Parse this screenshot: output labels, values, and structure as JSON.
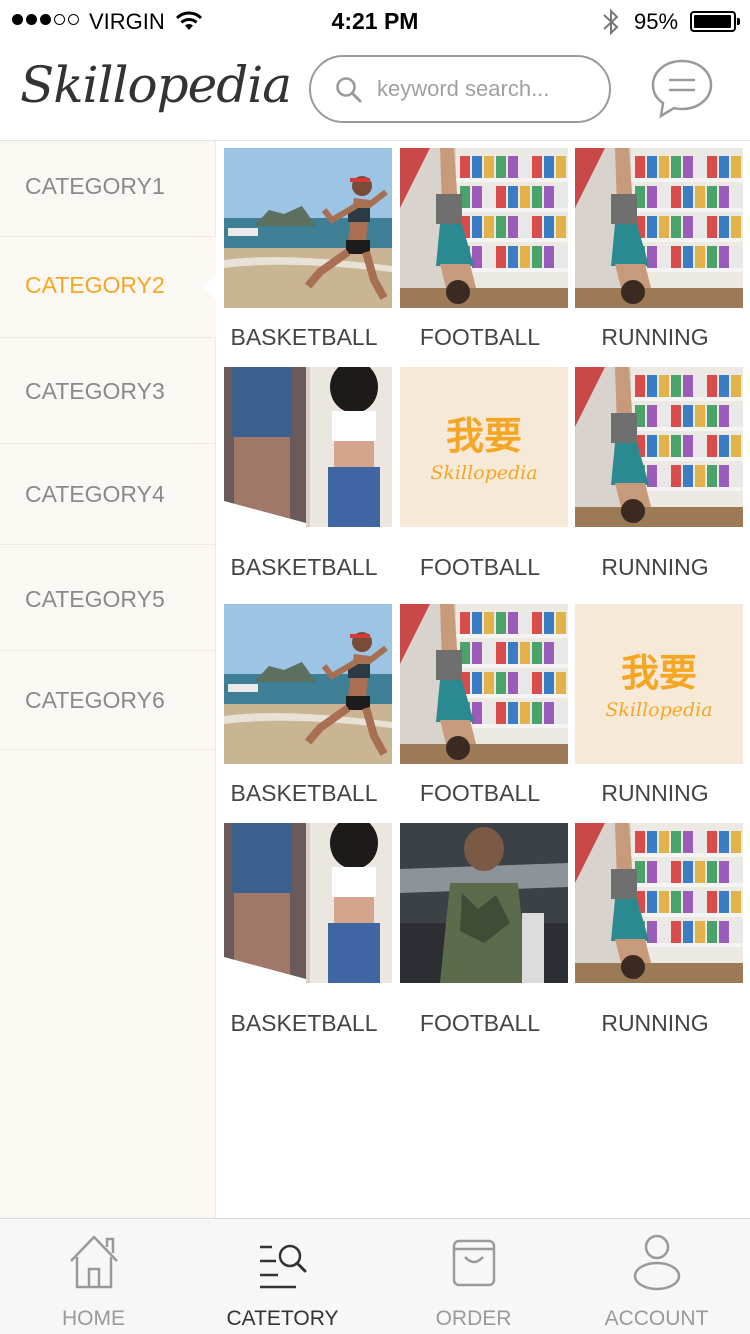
{
  "status_bar": {
    "carrier": "VIRGIN",
    "time": "4:21 PM",
    "battery": "95%"
  },
  "header": {
    "logo": "Skillopedia",
    "search_placeholder": "keyword search..."
  },
  "sidebar": {
    "items": [
      {
        "label": "CATEGORY1",
        "active": false
      },
      {
        "label": "CATEGORY2",
        "active": true
      },
      {
        "label": "CATEGORY3",
        "active": false
      },
      {
        "label": "CATEGORY4",
        "active": false
      },
      {
        "label": "CATEGORY5",
        "active": false
      },
      {
        "label": "CATEGORY6",
        "active": false
      }
    ]
  },
  "grid": {
    "items": [
      {
        "label": "BASKETBALL",
        "image": "beach-runner"
      },
      {
        "label": "FOOTBALL",
        "image": "handstand"
      },
      {
        "label": "RUNNING",
        "image": "handstand"
      },
      {
        "label": "BASKETBALL",
        "image": "mirror-selfie"
      },
      {
        "label": "FOOTBALL",
        "image": "skillopedia-logo"
      },
      {
        "label": "RUNNING",
        "image": "handstand"
      },
      {
        "label": "BASKETBALL",
        "image": "beach-runner"
      },
      {
        "label": "FOOTBALL",
        "image": "handstand"
      },
      {
        "label": "RUNNING",
        "image": "skillopedia-logo"
      },
      {
        "label": "BASKETBALL",
        "image": "mirror-selfie"
      },
      {
        "label": "FOOTBALL",
        "image": "gym-back"
      },
      {
        "label": "RUNNING",
        "image": "handstand"
      }
    ],
    "logo_cn": "我要",
    "logo_en": "Skillopedia"
  },
  "tabbar": {
    "items": [
      {
        "label": "HOME",
        "icon": "home-icon",
        "active": false
      },
      {
        "label": "CATETORY",
        "icon": "category-search-icon",
        "active": true
      },
      {
        "label": "ORDER",
        "icon": "shopping-bag-icon",
        "active": false
      },
      {
        "label": "ACCOUNT",
        "icon": "person-icon",
        "active": false
      }
    ]
  },
  "colors": {
    "accent": "#f5a623",
    "sidebar_bg": "#fbf8f3",
    "logo_tile_bg": "#f6e9d8"
  }
}
